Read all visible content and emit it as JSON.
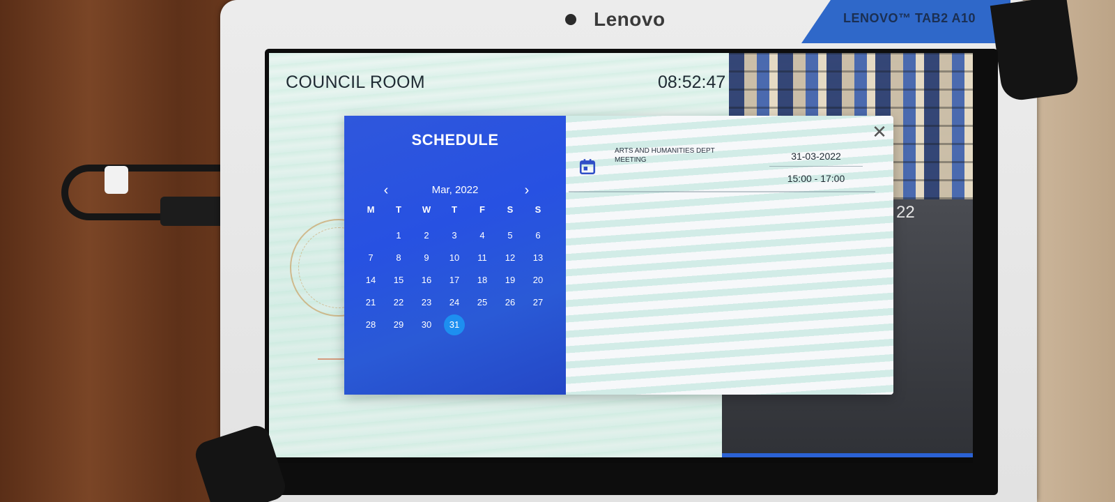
{
  "device": {
    "brand": "Lenovo",
    "model_label": "LENOVO™ TAB2 A10"
  },
  "screen": {
    "room_name": "COUNCIL ROOM",
    "clock": "08:52:47",
    "background_date_fragment": "22"
  },
  "schedule_modal": {
    "title": "SCHEDULE",
    "calendar": {
      "month_label": "Mar, 2022",
      "prev_icon": "chevron-left-icon",
      "next_icon": "chevron-right-icon",
      "weekdays": [
        "M",
        "T",
        "W",
        "T",
        "F",
        "S",
        "S"
      ],
      "leading_blanks": 1,
      "days": [
        "1",
        "2",
        "3",
        "4",
        "5",
        "6",
        "7",
        "8",
        "9",
        "10",
        "11",
        "12",
        "13",
        "14",
        "15",
        "16",
        "17",
        "18",
        "19",
        "20",
        "21",
        "22",
        "23",
        "24",
        "25",
        "26",
        "27",
        "28",
        "29",
        "30",
        "31"
      ],
      "selected_day": "31"
    },
    "close_icon": "close-icon",
    "events": [
      {
        "title": "ARTS AND HUMANITIES DEPT MEETING",
        "date": "31-03-2022",
        "time": "15:00 - 17:00",
        "icon": "calendar-icon"
      }
    ]
  },
  "navigation_bar": {
    "back_icon": "back-triangle-icon",
    "home_icon": "home-circle-icon",
    "recents_icon": "recents-square-icon"
  },
  "colors": {
    "calendar_panel": "#2751e2",
    "selected_day": "#1d8ff0",
    "event_icon": "#2f4fc7"
  }
}
